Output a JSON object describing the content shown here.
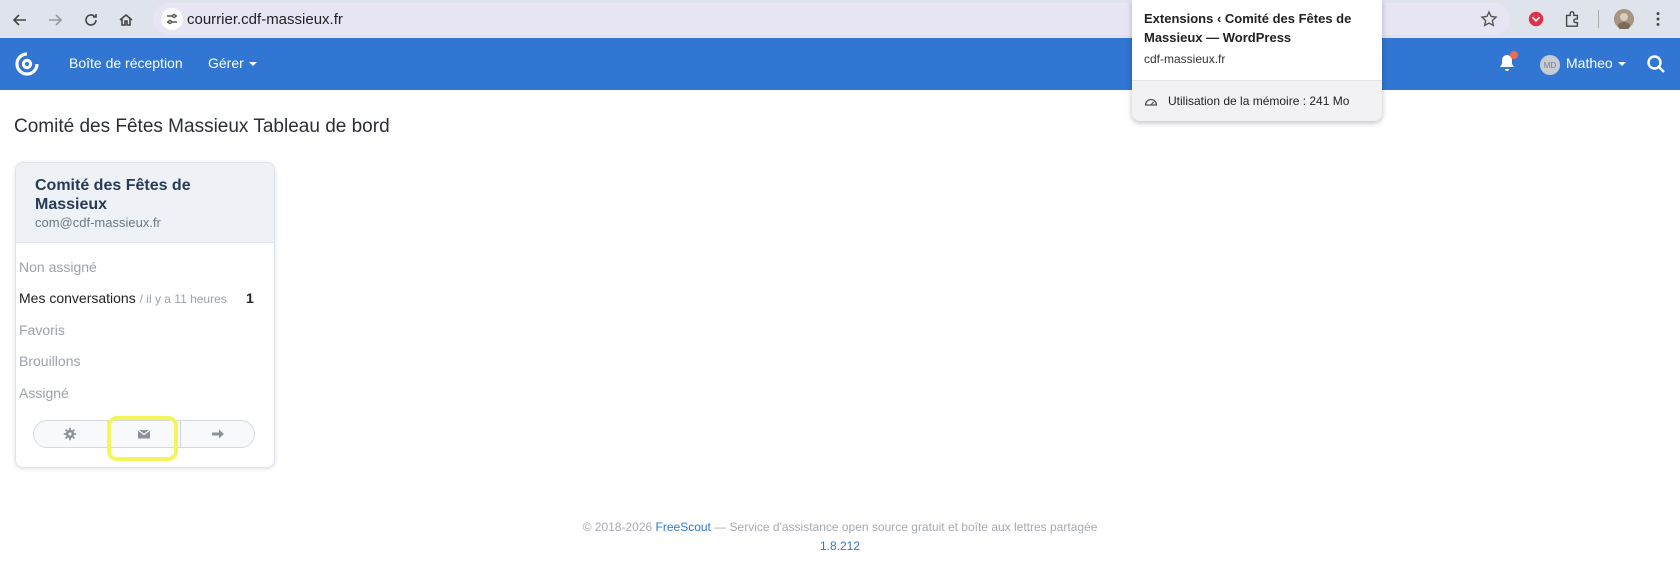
{
  "browser": {
    "url": "courrier.cdf-massieux.fr"
  },
  "tooltip": {
    "title": "Extensions ‹ Comité des Fêtes de Massieux — WordPress",
    "host": "cdf-massieux.fr",
    "memory": "Utilisation de la mémoire : 241 Mo"
  },
  "navbar": {
    "inbox_label": "Boîte de réception",
    "manage_label": "Gérer",
    "user_initials": "MD",
    "user_name": "Matheo",
    "brand_color": "#3176d2"
  },
  "page": {
    "title": "Comité des Fêtes Massieux Tableau de bord"
  },
  "mailbox": {
    "name": "Comité des Fêtes de Massieux",
    "email": "com@cdf-massieux.fr",
    "folders": [
      {
        "label": "Non assigné",
        "meta": "",
        "count": ""
      },
      {
        "label": "Mes conversations",
        "meta": "/ il y a 11 heures",
        "count": "1"
      },
      {
        "label": "Favoris",
        "meta": "",
        "count": ""
      },
      {
        "label": "Brouillons",
        "meta": "",
        "count": ""
      },
      {
        "label": "Assigné",
        "meta": "",
        "count": ""
      }
    ],
    "actions": [
      "gear-icon",
      "envelope-icon",
      "arrow-right-icon"
    ]
  },
  "footer": {
    "copyright": "© 2018-2026",
    "product": "FreeScout",
    "tagline": " — Service d'assistance open source gratuit et boîte aux lettres partagée",
    "version": "1.8.212"
  }
}
